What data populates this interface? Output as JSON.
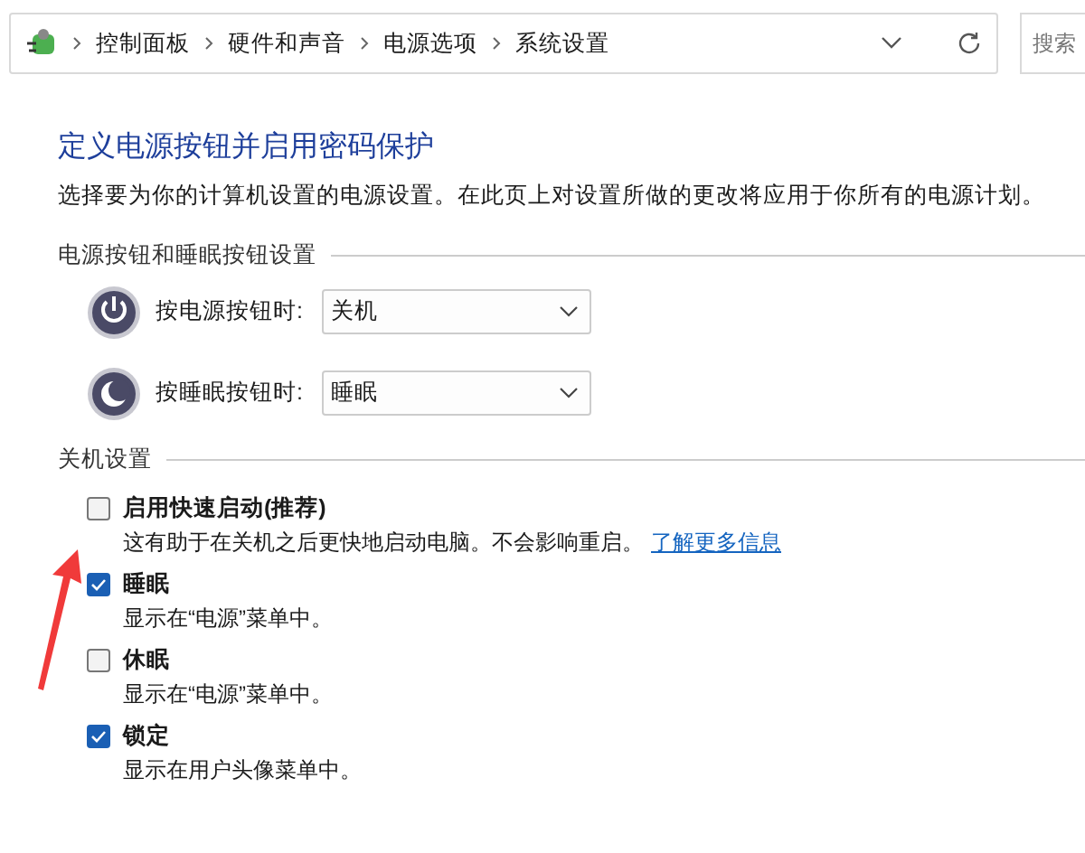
{
  "address_bar": {
    "breadcrumbs": [
      "控制面板",
      "硬件和声音",
      "电源选项",
      "系统设置"
    ]
  },
  "search": {
    "placeholder": "搜索"
  },
  "title": "定义电源按钮并启用密码保护",
  "description": "选择要为你的计算机设置的电源设置。在此页上对设置所做的更改将应用于你所有的电源计划。",
  "button_section": {
    "heading": "电源按钮和睡眠按钮设置",
    "rows": [
      {
        "kind": "power",
        "label": "按电源按钮时:",
        "value": "关机"
      },
      {
        "kind": "sleep",
        "label": "按睡眠按钮时:",
        "value": "睡眠"
      }
    ]
  },
  "shutdown_section": {
    "heading": "关机设置",
    "options": [
      {
        "label": "启用快速启动(推荐)",
        "checked": false,
        "description": "这有助于在关机之后更快地启动电脑。不会影响重启。",
        "link": "了解更多信息"
      },
      {
        "label": "睡眠",
        "checked": true,
        "description": "显示在“电源”菜单中。"
      },
      {
        "label": "休眠",
        "checked": false,
        "description": "显示在“电源”菜单中。"
      },
      {
        "label": "锁定",
        "checked": true,
        "description": "显示在用户头像菜单中。"
      }
    ]
  }
}
